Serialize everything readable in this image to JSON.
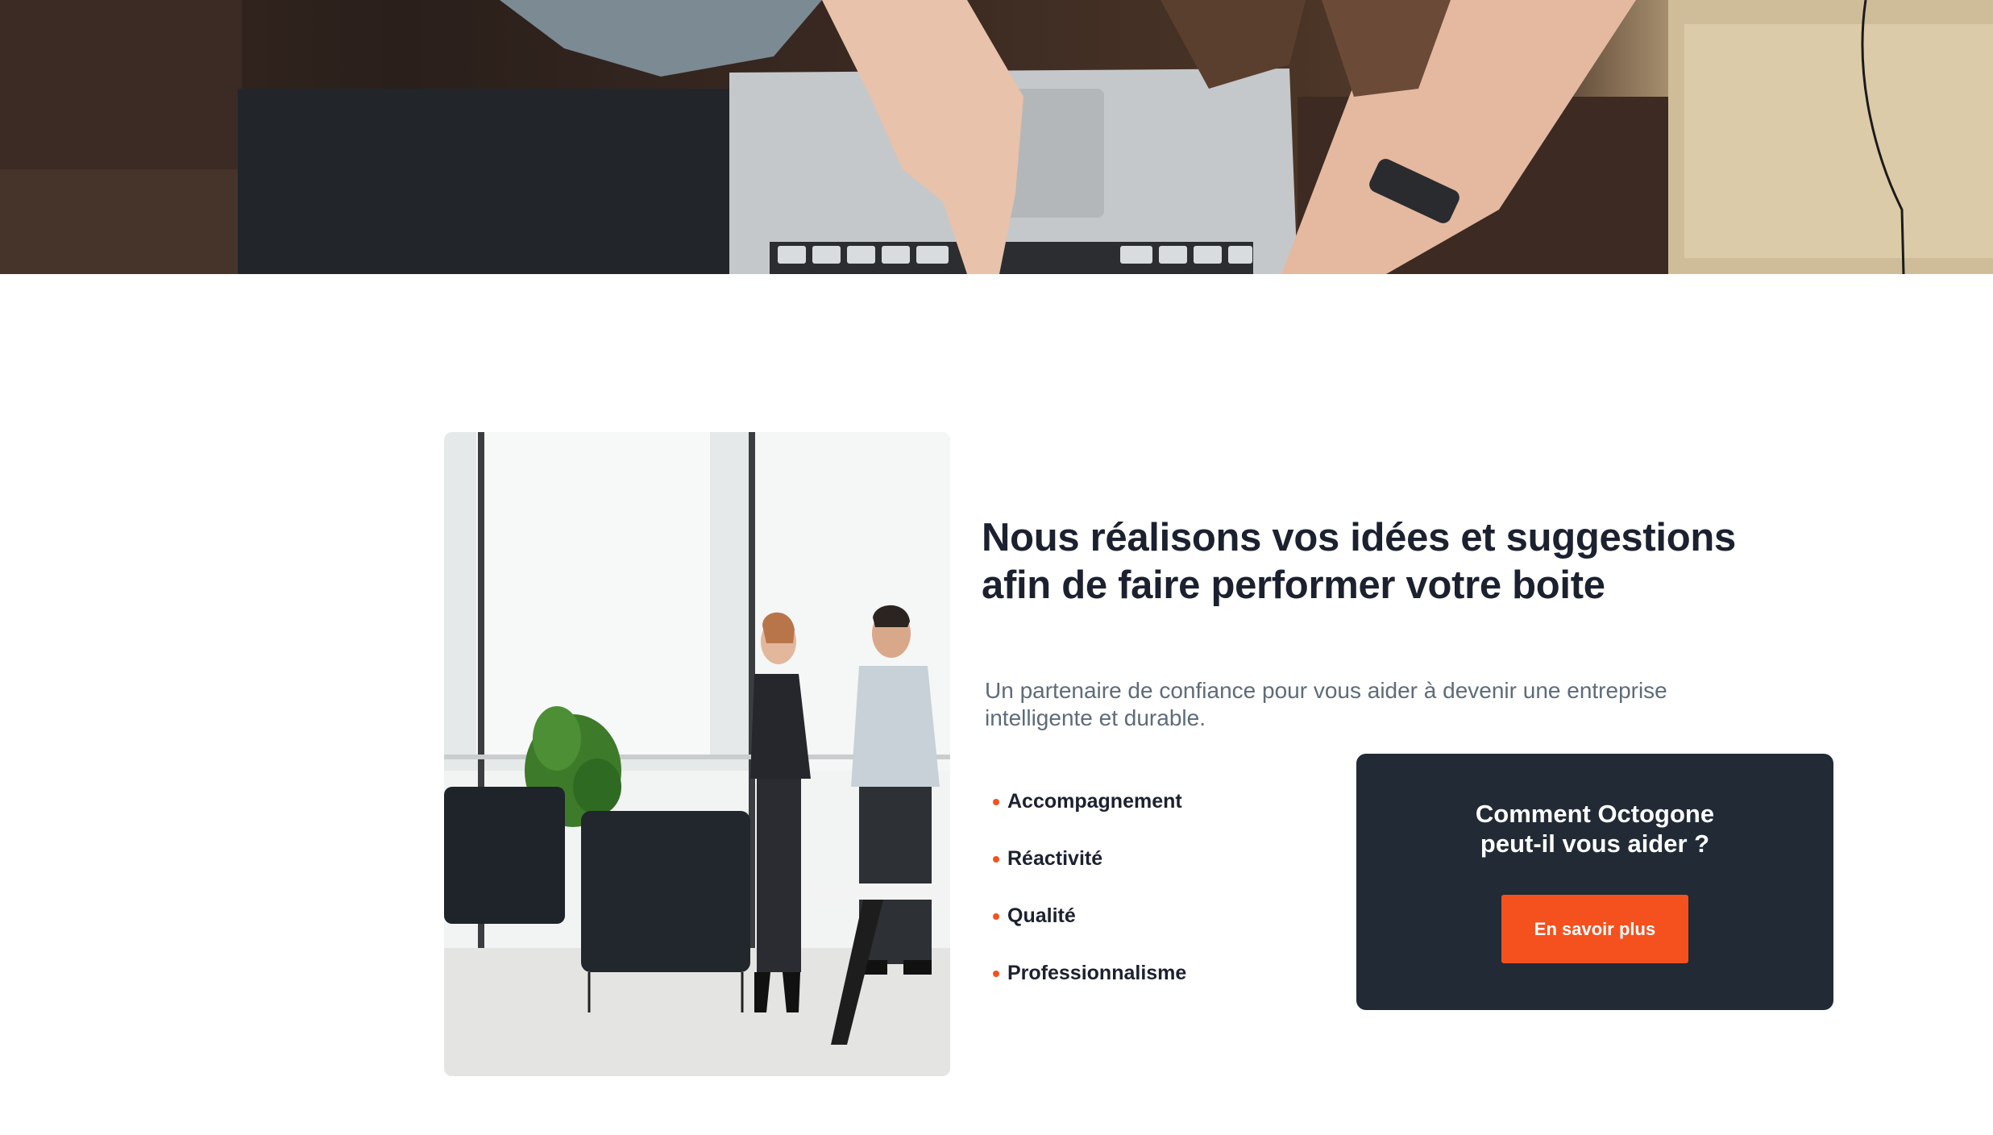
{
  "hero": {
    "image": "team-laptop-photo"
  },
  "about": {
    "photo": "office-meeting-photo",
    "headline_line1": "Nous réalisons vos idées et suggestions",
    "headline_line2": "afin de faire performer votre boite",
    "subtitle": "Un partenaire de confiance pour vous aider à devenir une entreprise intelligente et durable.",
    "features": [
      "Accompagnement",
      "Réactivité",
      "Qualité",
      "Professionnalisme"
    ]
  },
  "cta": {
    "title_line1": "Comment Octogone",
    "title_line2": "peut-il vous aider ?",
    "button_label": "En savoir plus"
  },
  "colors": {
    "accent": "#f4511e",
    "dark_card": "#212a35",
    "heading": "#1c2130",
    "body_text": "#5e6b7a"
  }
}
